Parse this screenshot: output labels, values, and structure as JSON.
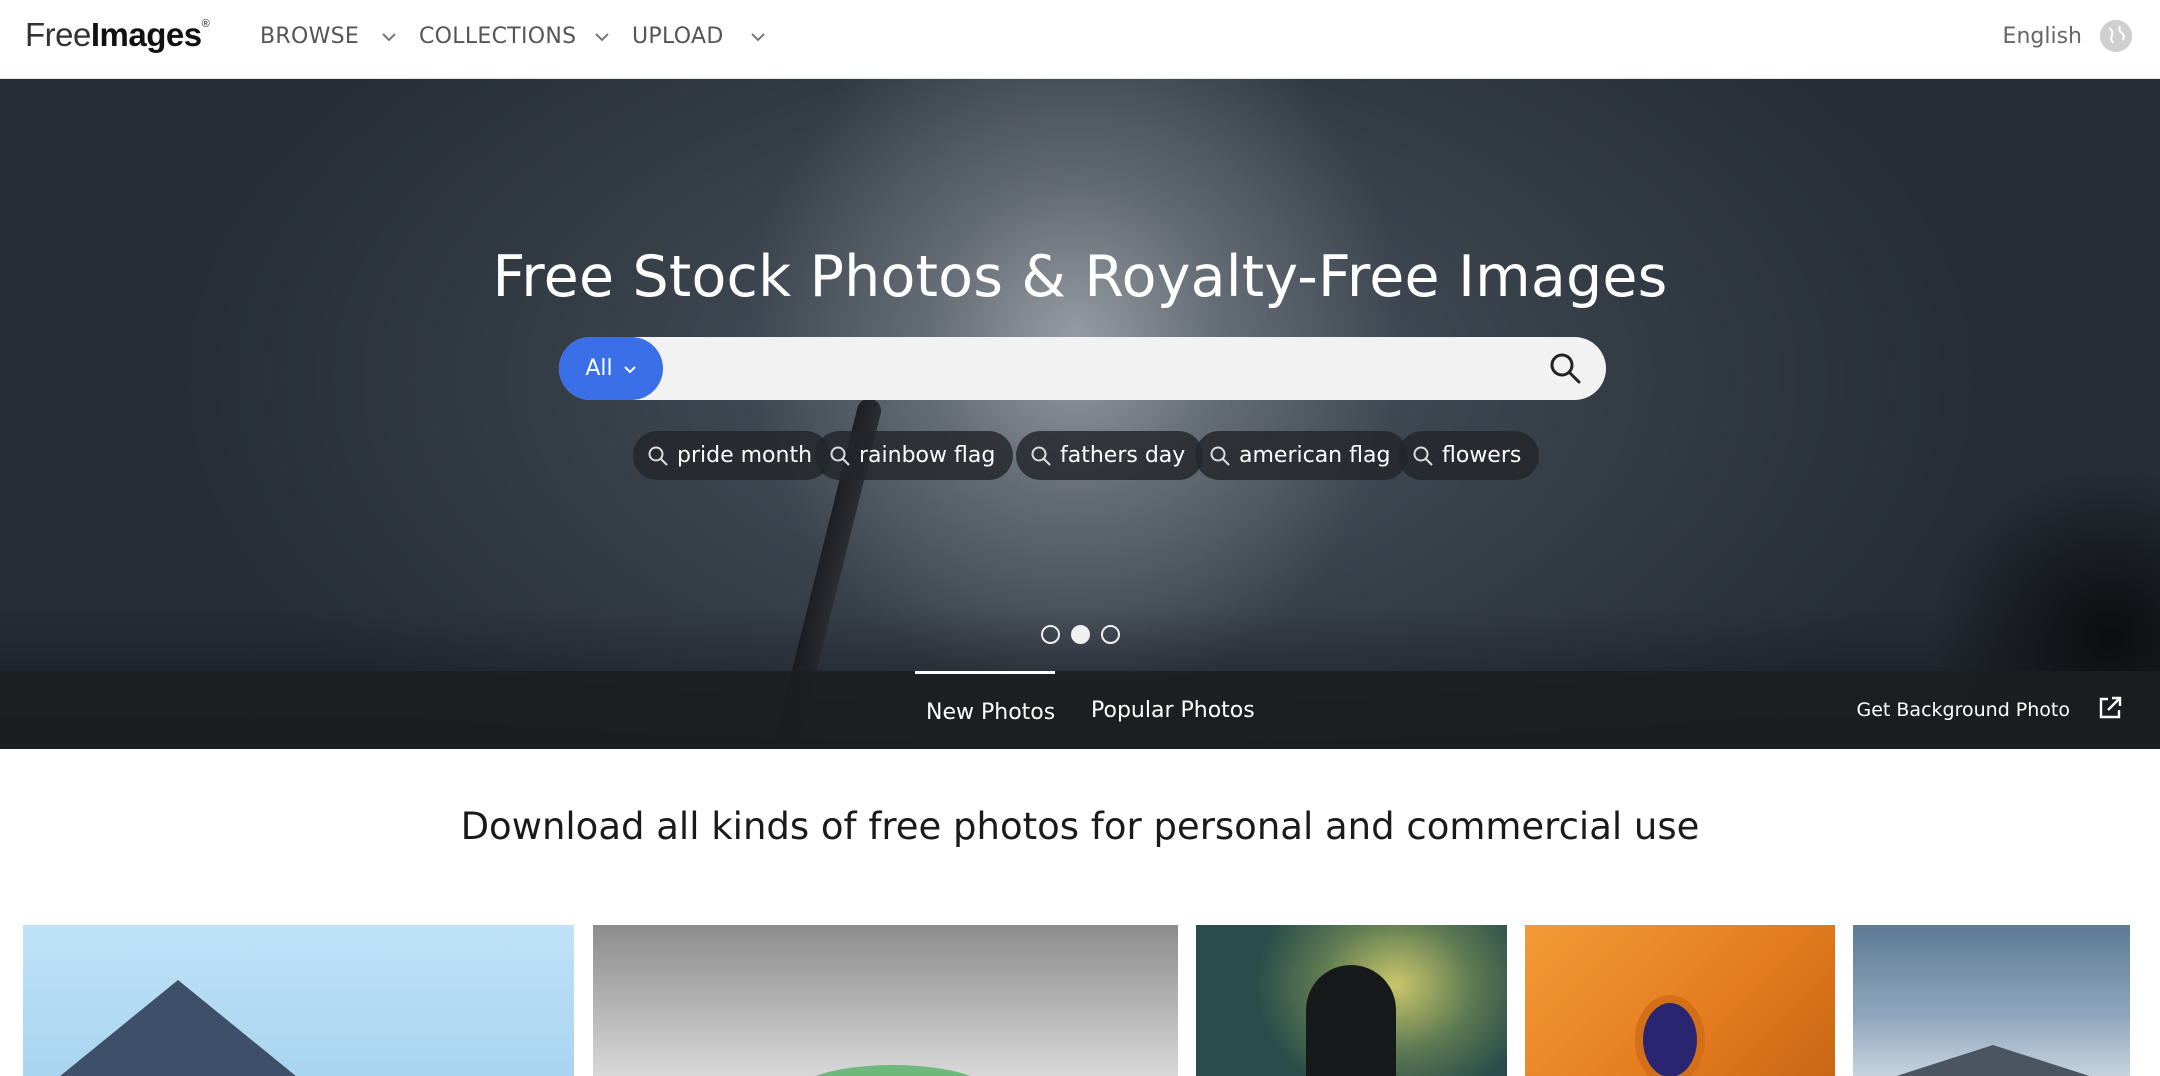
{
  "header": {
    "logo_part1": "Free",
    "logo_part2": "Images",
    "logo_mark": "®",
    "nav": [
      {
        "label": "BROWSE"
      },
      {
        "label": "COLLECTIONS"
      },
      {
        "label": "UPLOAD"
      }
    ],
    "language": "English"
  },
  "hero": {
    "title": "Free Stock Photos & Royalty-Free Images",
    "search": {
      "type_label": "All",
      "placeholder": "",
      "value": ""
    },
    "suggestions": [
      {
        "label": "pride month"
      },
      {
        "label": "rainbow flag"
      },
      {
        "label": "fathers day"
      },
      {
        "label": "american flag"
      },
      {
        "label": "flowers"
      }
    ],
    "carousel": {
      "count": 3,
      "active_index": 1
    },
    "tabs": [
      {
        "label": "New Photos",
        "active": true
      },
      {
        "label": "Popular Photos",
        "active": false
      }
    ],
    "background_link": "Get Background Photo"
  },
  "section": {
    "title": "Download all kinds of free photos for personal and commercial use"
  },
  "colors": {
    "accent": "#3a6fe8",
    "chip_bg": "#23262b"
  },
  "icons": {
    "search": "search-icon",
    "chevron": "chevron-down-icon",
    "globe": "globe-icon",
    "external": "external-link-icon"
  }
}
